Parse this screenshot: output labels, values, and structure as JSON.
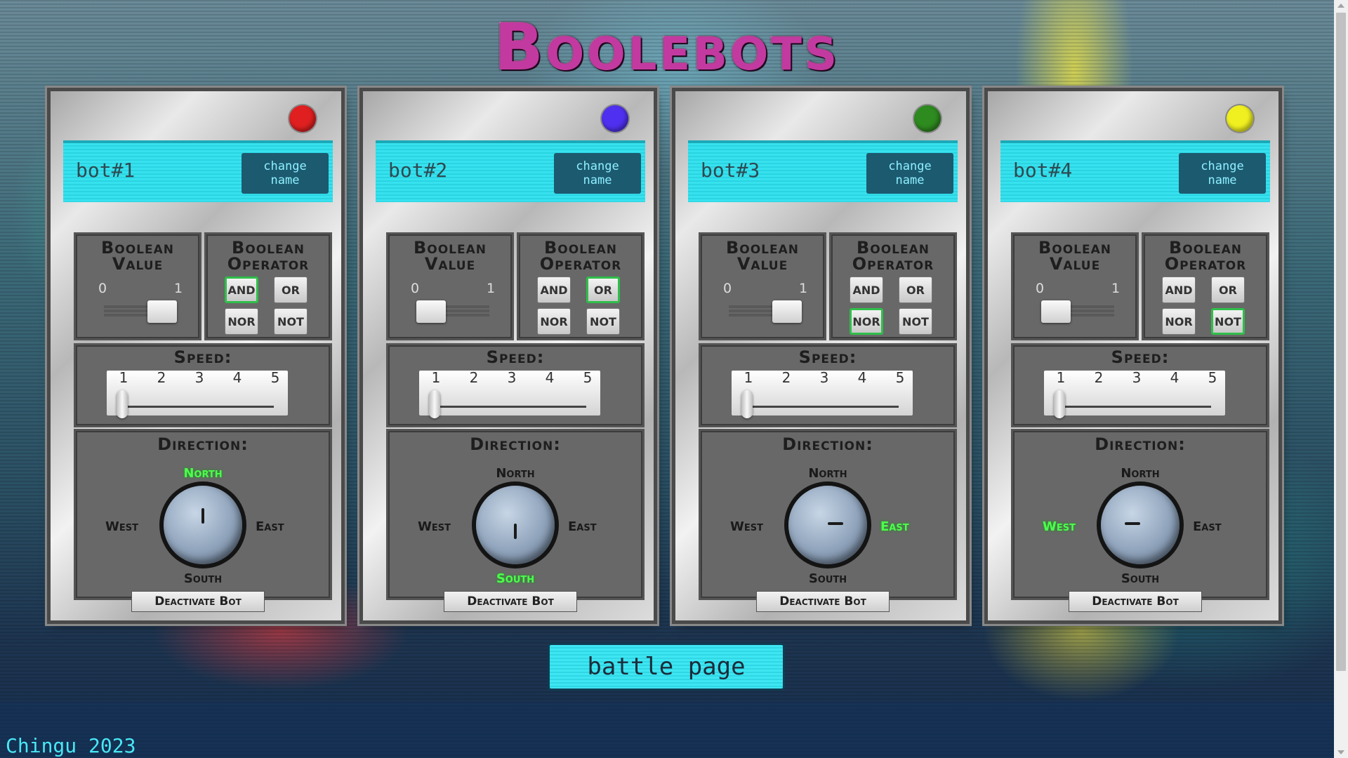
{
  "app": {
    "title": "Boolebots",
    "footer": "Chingu 2023"
  },
  "labels": {
    "change_name": "change name",
    "boolean_value": "Boolean Value",
    "boolean_operator": "Boolean Operator",
    "zero": "0",
    "one": "1",
    "speed": "Speed:",
    "speed_ticks": [
      "1",
      "2",
      "3",
      "4",
      "5"
    ],
    "direction": "Direction:",
    "north": "North",
    "south": "South",
    "west": "West",
    "east": "East",
    "and": "AND",
    "or": "OR",
    "nor": "NOR",
    "not": "NOT",
    "deactivate": "Deactivate Bot"
  },
  "bots": [
    {
      "name": "bot#1",
      "led_color": "#e02020",
      "boolean_value": 1,
      "operator": "AND",
      "speed": 1,
      "direction": "North"
    },
    {
      "name": "bot#2",
      "led_color": "#5030f0",
      "boolean_value": 0,
      "operator": "OR",
      "speed": 1,
      "direction": "South"
    },
    {
      "name": "bot#3",
      "led_color": "#2e8b1f",
      "boolean_value": 1,
      "operator": "NOR",
      "speed": 1,
      "direction": "East"
    },
    {
      "name": "bot#4",
      "led_color": "#f0f020",
      "boolean_value": 0,
      "operator": "NOT",
      "speed": 1,
      "direction": "West"
    }
  ],
  "battle_button": "battle page",
  "colors": {
    "accent": "#37e2ee",
    "active": "#4dff4d",
    "title": "#c23aa0"
  }
}
